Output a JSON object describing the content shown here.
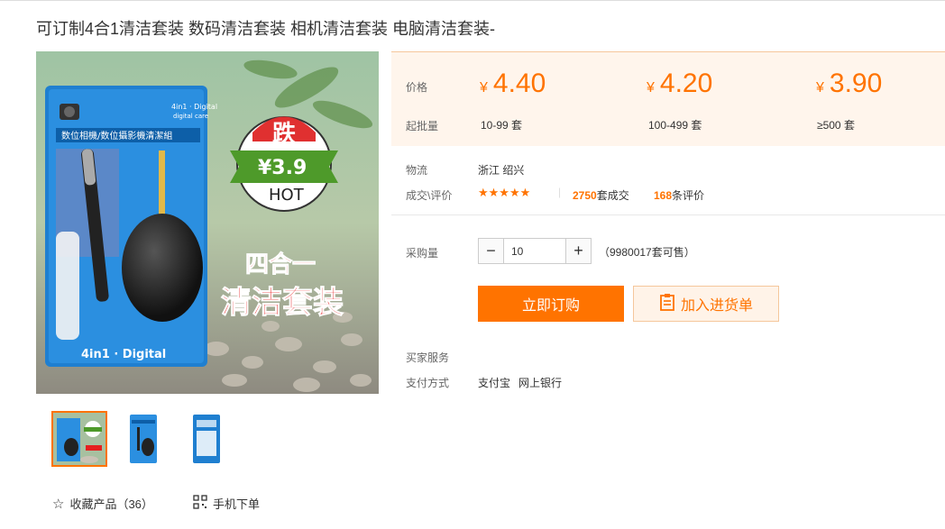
{
  "product": {
    "title": "可订制4合1清洁套装 数码清洁套装 相机清洁套装 电脑清洁套装-"
  },
  "main_image": {
    "package_top_text": "4in1 · Digital",
    "package_top_sub": "digital care",
    "package_band": "数位相機/数位攝影機清潔組",
    "package_bottom": "4in1 · Digital",
    "badge_top": "跌",
    "badge_price": "¥3.9",
    "badge_hot": "HOT",
    "overlay_line1": "四合一",
    "overlay_line2": "清洁套装"
  },
  "actions": {
    "favorite_label": "收藏产品（36）",
    "mobile_label": "手机下单"
  },
  "pricing": {
    "price_label": "价格",
    "moq_label": "起批量",
    "currency": "¥",
    "tiers": [
      {
        "price": "4.40",
        "range": "10-99 套"
      },
      {
        "price": "4.20",
        "range": "100-499 套"
      },
      {
        "price": "3.90",
        "range": "≥500 套"
      }
    ]
  },
  "logistics": {
    "label": "物流",
    "value": "浙江 绍兴"
  },
  "reviews": {
    "label": "成交\\评价",
    "stars": "★★★★★",
    "deal_count": "2750",
    "deal_suffix": "套成交",
    "review_count": "168",
    "review_suffix": "条评价"
  },
  "purchase": {
    "qty_label": "采购量",
    "quantity": "10",
    "minus": "−",
    "plus": "+",
    "stock": "（9980017套可售）",
    "buy_label": "立即订购",
    "cart_label": "加入进货单"
  },
  "service": {
    "buyer_service_label": "买家服务",
    "payment_label": "支付方式",
    "payment_methods": [
      "支付宝",
      "网上银行"
    ]
  },
  "colors": {
    "accent": "#ff7300",
    "price_bg": "#fff5ec"
  }
}
